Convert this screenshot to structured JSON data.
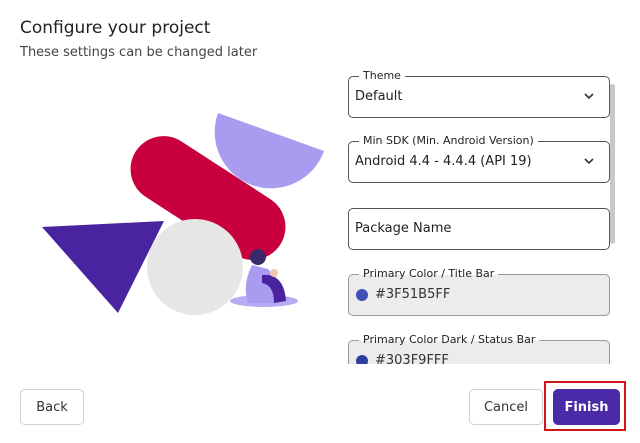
{
  "header": {
    "title": "Configure your project",
    "subtitle": "These settings can be changed later"
  },
  "form": {
    "theme": {
      "label": "Theme",
      "value": "Default"
    },
    "min_sdk": {
      "label": "Min SDK (Min. Android Version)",
      "value": "Android 4.4 - 4.4.4 (API 19)"
    },
    "package_name": {
      "placeholder": "Package Name"
    },
    "primary_color": {
      "label": "Primary Color / Title Bar",
      "value": "#3F51B5FF",
      "swatch": "#3F51B5"
    },
    "primary_color_dark": {
      "label": "Primary Color Dark / Status Bar",
      "value": "#303F9FFF",
      "swatch": "#303F9F"
    }
  },
  "footer": {
    "back_label": "Back",
    "cancel_label": "Cancel",
    "finish_label": "Finish"
  },
  "colors": {
    "accent": "#4A2AA6",
    "highlight_border": "#D0141B",
    "illustration_red": "#C8003E",
    "illustration_purple": "#4A23A0",
    "illustration_lilac": "#A99BF0"
  }
}
